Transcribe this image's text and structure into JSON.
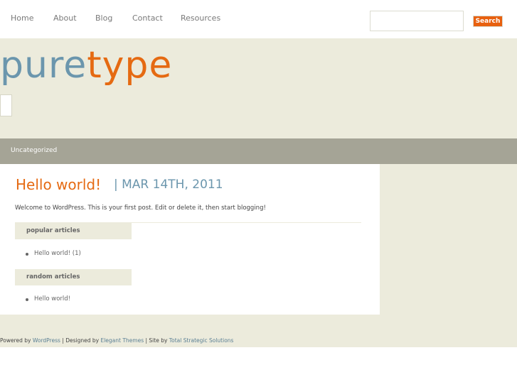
{
  "nav": {
    "items": [
      "Home",
      "About",
      "Blog",
      "Contact",
      "Resources"
    ],
    "search_placeholder": "",
    "search_button": "Search"
  },
  "logo": {
    "part1": "pure",
    "part2": "type"
  },
  "categories": {
    "items": [
      "Uncategorized"
    ]
  },
  "post": {
    "title": "Hello world!",
    "date": "| MAR 14TH, 2011",
    "excerpt": "Welcome to WordPress. This is your first post. Edit or delete it, then start blogging!"
  },
  "widgets": {
    "popular": {
      "title": "popular articles",
      "items": [
        "Hello world! (1)"
      ]
    },
    "random": {
      "title": "random articles",
      "items": [
        "Hello world!"
      ]
    }
  },
  "footer": {
    "powered_by": "Powered by",
    "wordpress": "WordPress",
    "designed_by": "| Designed by",
    "elegant": "Elegant Themes",
    "site_by": "| Site by",
    "tss": "Total Strategic Solutions"
  },
  "colors": {
    "accent_orange": "#e56a12",
    "accent_blue": "#6b96ad",
    "background_beige": "#ecebdc",
    "category_bar": "#a5a496"
  }
}
